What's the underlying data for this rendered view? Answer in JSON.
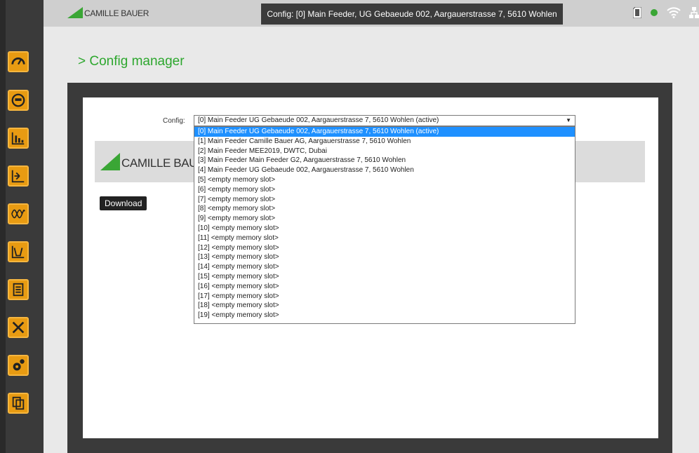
{
  "header": {
    "logo_text": "CAMILLE BAUER",
    "title": "Config: [0] Main Feeder, UG Gebaeude 002, Aargauerstrasse 7, 5610 Wohlen",
    "status_icons": [
      "sd-card-icon",
      "status-dot-icon",
      "wifi-icon",
      "network-icon"
    ]
  },
  "page": {
    "heading": "> Config manager"
  },
  "config": {
    "label": "Config:",
    "selected": "[0] Main Feeder UG Gebaeude 002, Aargauerstrasse 7, 5610 Wohlen (active)",
    "options": [
      "[0] Main Feeder UG Gebaeude 002, Aargauerstrasse 7, 5610 Wohlen (active)",
      "[1] Main Feeder Camille Bauer AG, Aargauerstrasse 7, 5610 Wohlen",
      "[2] Main Feeder MEE2019, DWTC, Dubai",
      "[3] Main Feeder Main Feeder G2, Aargauerstrasse 7, 5610 Wohlen",
      "[4] Main Feeder UG Gebaeude 002, Aargauerstrasse 7, 5610 Wohlen",
      "[5] <empty memory slot>",
      "[6] <empty memory slot>",
      "[7] <empty memory slot>",
      "[8] <empty memory slot>",
      "[9] <empty memory slot>",
      "[10] <empty memory slot>",
      "[11] <empty memory slot>",
      "[12] <empty memory slot>",
      "[13] <empty memory slot>",
      "[14] <empty memory slot>",
      "[15] <empty memory slot>",
      "[16] <empty memory slot>",
      "[17] <empty memory slot>",
      "[18] <empty memory slot>",
      "[19] <empty memory slot>"
    ],
    "selected_index": 0
  },
  "banner": {
    "logo_text": "CAMILLE BAUER"
  },
  "actions": {
    "download_label": "Download"
  },
  "sidebar": {
    "items": [
      "gauge-icon",
      "meter-icon",
      "bar-chart-icon",
      "phasor-icon",
      "harmonics-icon",
      "waveform-icon",
      "list-icon",
      "tools-icon",
      "settings-gear-icon",
      "files-icon"
    ]
  },
  "colors": {
    "accent_green": "#2da72e",
    "nav_orange": "#e89b12",
    "selection_blue": "#1e90ff"
  }
}
